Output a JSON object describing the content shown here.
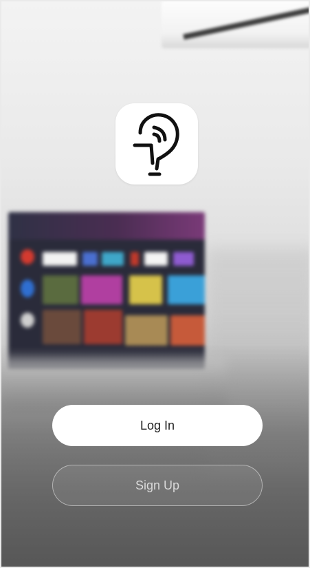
{
  "app_icon": {
    "icon": "remote-signal-hand-icon"
  },
  "buttons": {
    "login_label": "Log In",
    "signup_label": "Sign Up"
  },
  "colors": {
    "login_bg": "#ffffff",
    "login_text": "#222222",
    "signup_text": "#d9d9d9"
  }
}
